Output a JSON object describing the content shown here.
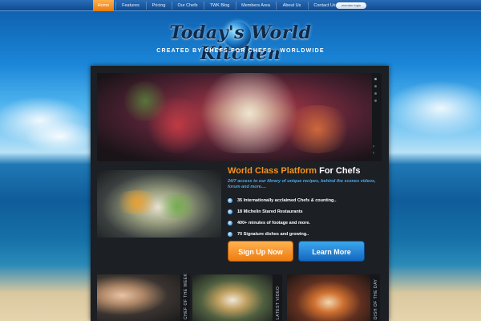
{
  "nav": {
    "items": [
      {
        "label": "Home",
        "active": true
      },
      {
        "label": "Features",
        "active": false
      },
      {
        "label": "Pricing",
        "active": false
      },
      {
        "label": "Our Chefs",
        "active": false
      },
      {
        "label": "TWK Blog",
        "active": false
      },
      {
        "label": "Members Area",
        "active": false
      },
      {
        "label": "About Us",
        "active": false
      },
      {
        "label": "Contact Us",
        "active": false
      }
    ],
    "member_login": "member login"
  },
  "header": {
    "logo_text": "Today's World Kitchen",
    "tagline": "CREATED BY CHEFS FOR CHEFS - WORLDWIDE"
  },
  "hero": {
    "headline_accent": "World Class Platform",
    "headline_rest": " For Chefs",
    "intro": "24/7 access to our library of unique recipes, behind the scenes videos, forum and more....",
    "bullets": [
      "35 Internationally acclaimed Chefs & counting..",
      "18 Michelin Stared Restaurants",
      "400+ minutes of footage and more.",
      "70 Signature dishes and growing.."
    ],
    "signup_label": "Sign Up Now",
    "learn_label": "Learn More"
  },
  "features": {
    "labels": [
      "CHEF OF THE WEEK",
      "LATEST VIDEO",
      "DISH OF THE DAY"
    ]
  },
  "colors": {
    "accent_orange": "#f7931e",
    "accent_blue": "#4aa8e8",
    "panel_bg": "#1c1f24",
    "nav_bg": "#0f4a8e"
  }
}
